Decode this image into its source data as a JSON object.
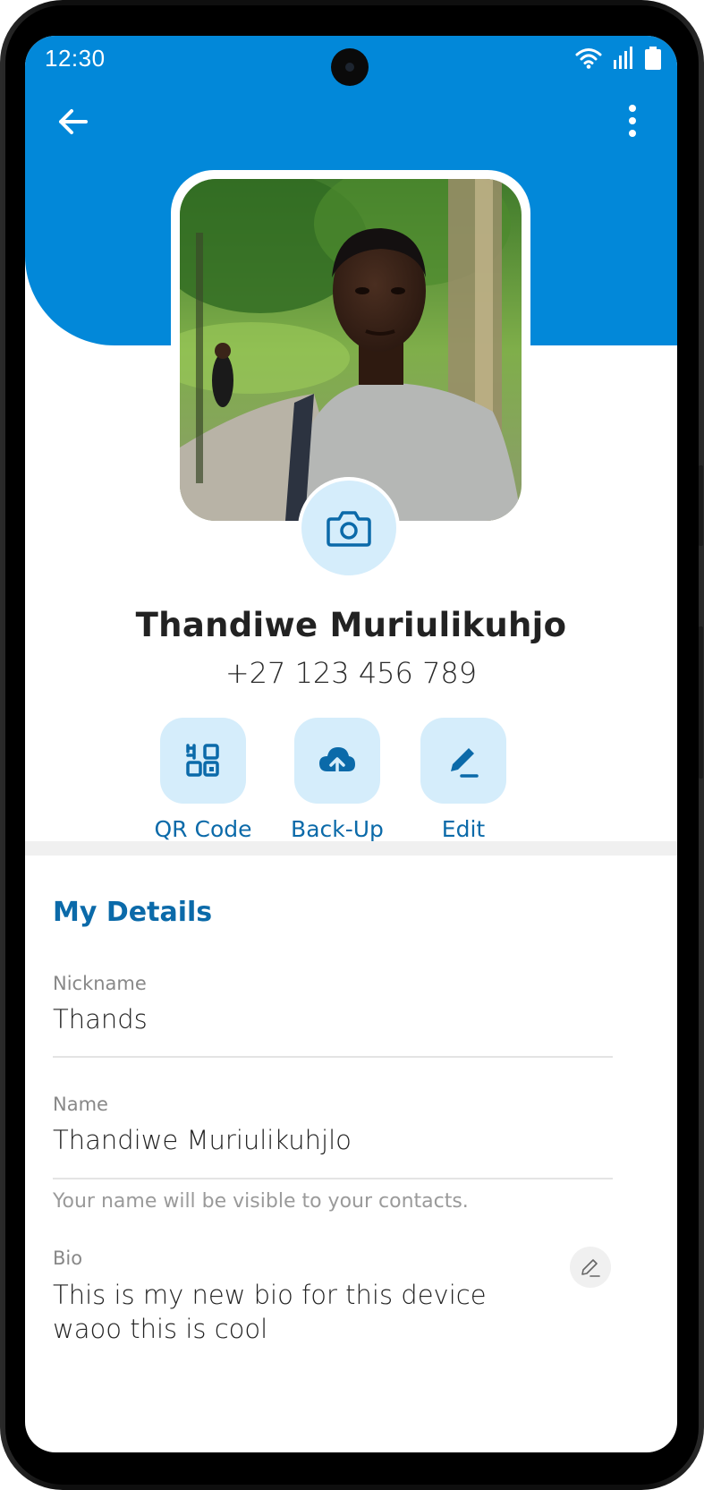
{
  "status_bar": {
    "time": "12:30",
    "icons": [
      "wifi-icon",
      "signal-icon",
      "battery-icon"
    ]
  },
  "header": {
    "back_icon": "arrow-left-icon",
    "more_icon": "more-vertical-icon",
    "accent_color": "#0288d9"
  },
  "profile": {
    "name": "Thandiwe Muriulikuhjo",
    "phone": "+27 123 456 789",
    "photo_icon": "camera-icon"
  },
  "actions": [
    {
      "label": "QR Code",
      "icon": "qr-code-icon"
    },
    {
      "label": "Back-Up",
      "icon": "cloud-upload-icon"
    },
    {
      "label": "Edit",
      "icon": "pencil-icon"
    }
  ],
  "details": {
    "title": "My Details",
    "nickname": {
      "label": "Nickname",
      "value": "Thands"
    },
    "name": {
      "label": "Name",
      "value": "Thandiwe Muriulikuhjlo",
      "hint": "Your name will be visible to your contacts."
    },
    "bio": {
      "label": "Bio",
      "value": "This is my new bio for this device waoo this is cool",
      "edit_icon": "pencil-icon"
    }
  },
  "colors": {
    "primary": "#0288d9",
    "primary_text": "#0b6aa9",
    "tile_bg": "#d5edfb"
  }
}
